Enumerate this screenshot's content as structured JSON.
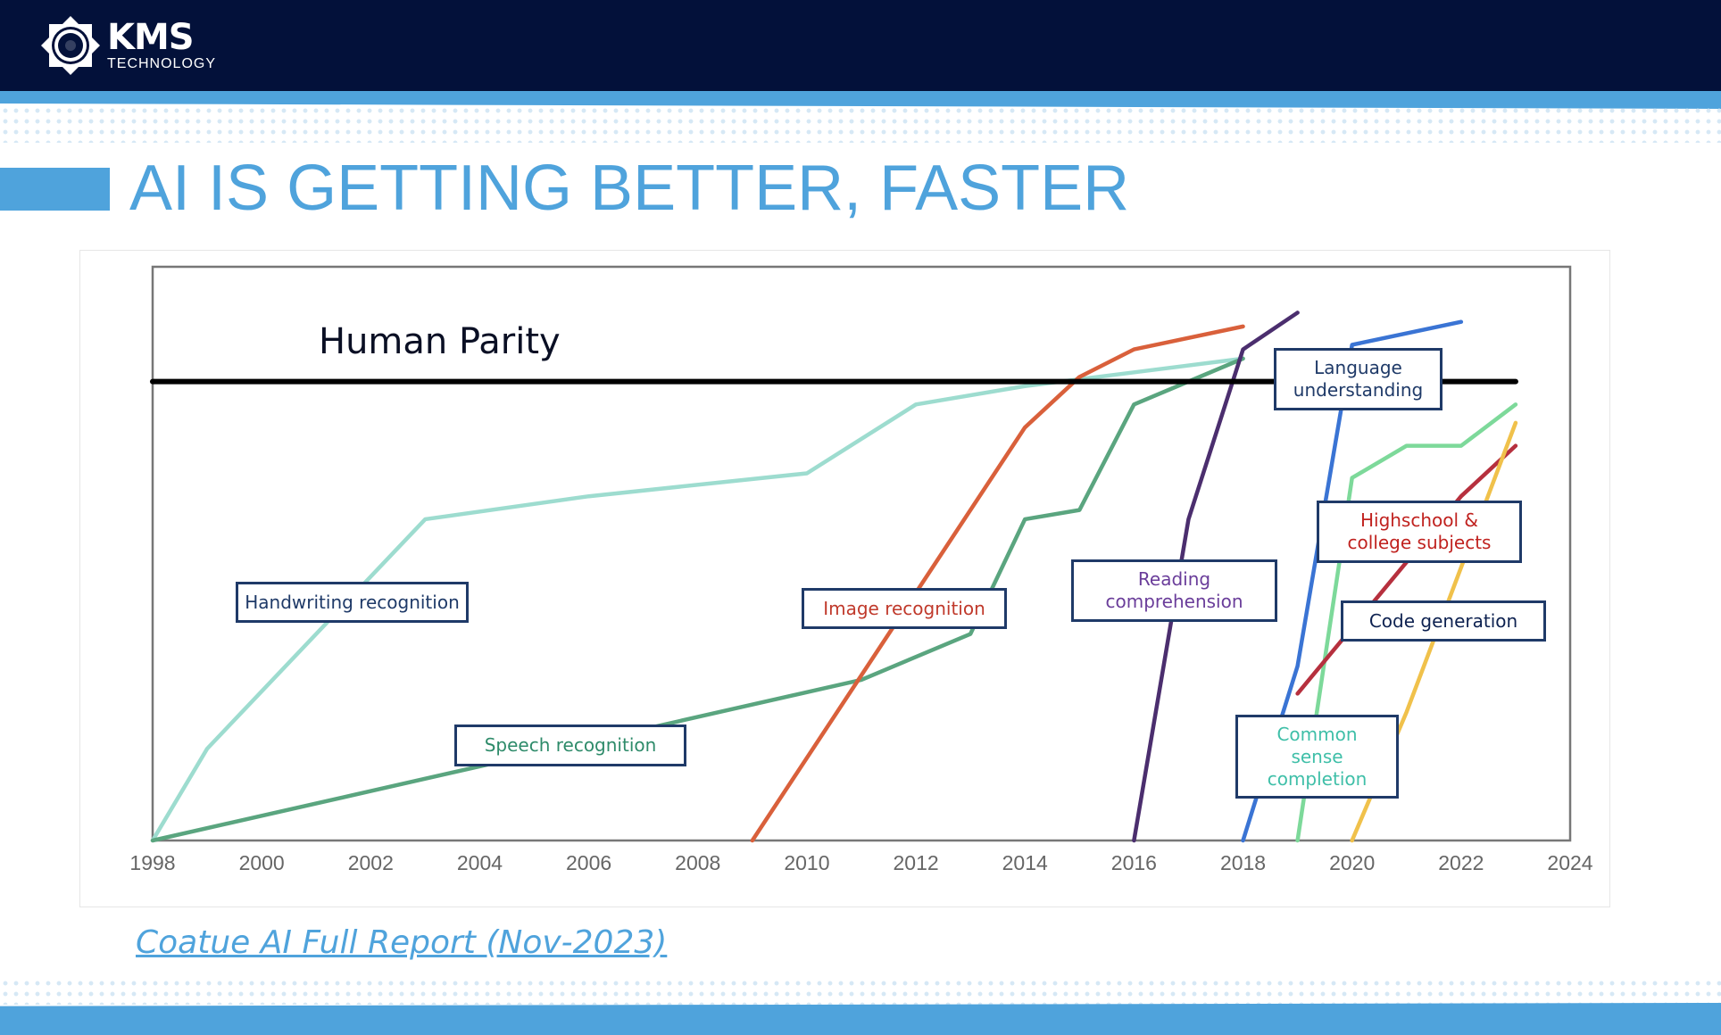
{
  "header": {
    "logo_main": "KMS",
    "logo_sub": "TECHNOLOGY"
  },
  "slide": {
    "title": "AI IS GETTING BETTER, FASTER",
    "source_link": "Coatue AI Full Report (Nov-2023)"
  },
  "colors": {
    "header_bg": "#03113a",
    "accent": "#4fa3dc",
    "label_border": "#1f3a68"
  },
  "chart_data": {
    "type": "line",
    "title": "",
    "xlabel": "",
    "ylabel": "",
    "xlim": [
      1998,
      2024
    ],
    "ylim": [
      -100,
      25
    ],
    "x_ticks": [
      "1998",
      "2000",
      "2002",
      "2004",
      "2006",
      "2008",
      "2010",
      "2012",
      "2014",
      "2016",
      "2018",
      "2020",
      "2022",
      "2024"
    ],
    "grid": false,
    "reference_line": {
      "label": "Human Parity",
      "y": 0,
      "x_range": [
        1998,
        2023
      ]
    },
    "series": [
      {
        "name": "Handwriting recognition",
        "color": "#9ddccf",
        "label_color": "#1f3a68",
        "points": [
          [
            1998,
            -100
          ],
          [
            1999,
            -80
          ],
          [
            2003,
            -30
          ],
          [
            2006,
            -25
          ],
          [
            2010,
            -20
          ],
          [
            2012,
            -5
          ],
          [
            2014,
            -1
          ],
          [
            2016,
            2
          ],
          [
            2018,
            5
          ]
        ]
      },
      {
        "name": "Speech recognition",
        "color": "#5aa57f",
        "label_color": "#2e8b6a",
        "points": [
          [
            1998,
            -100
          ],
          [
            2011,
            -65
          ],
          [
            2013,
            -55
          ],
          [
            2014,
            -30
          ],
          [
            2015,
            -28
          ],
          [
            2016,
            -5
          ],
          [
            2018,
            5
          ]
        ]
      },
      {
        "name": "Image recognition",
        "color": "#d9603b",
        "label_color": "#c0392b",
        "points": [
          [
            2009,
            -100
          ],
          [
            2014,
            -10
          ],
          [
            2015,
            1
          ],
          [
            2016,
            7
          ],
          [
            2018,
            12
          ]
        ]
      },
      {
        "name": "Reading comprehension",
        "color": "#4b2e6e",
        "label_color": "#6a3d9a",
        "points": [
          [
            2016,
            -100
          ],
          [
            2017,
            -30
          ],
          [
            2018,
            7
          ],
          [
            2019,
            15
          ]
        ]
      },
      {
        "name": "Language understanding",
        "color": "#3a74d4",
        "label_color": "#1f3a68",
        "points": [
          [
            2018,
            -100
          ],
          [
            2019,
            -62
          ],
          [
            2019.8,
            -6
          ],
          [
            2020,
            8
          ],
          [
            2022,
            13
          ]
        ]
      },
      {
        "name": "Common sense completion",
        "color": "#7dd99a",
        "label_color": "#3fbfa8",
        "points": [
          [
            2019,
            -100
          ],
          [
            2020,
            -21
          ],
          [
            2021,
            -14
          ],
          [
            2022,
            -14
          ],
          [
            2023,
            -5
          ]
        ]
      },
      {
        "name": "Highschool & college subjects",
        "color": "#b6303e",
        "label_color": "#c0221f",
        "points": [
          [
            2019,
            -68
          ],
          [
            2022,
            -25
          ],
          [
            2023,
            -14
          ]
        ]
      },
      {
        "name": "Code generation",
        "color": "#f0c14b",
        "label_color": "#0d2150",
        "points": [
          [
            2020,
            -100
          ],
          [
            2021,
            -72
          ],
          [
            2023,
            -9
          ]
        ]
      }
    ]
  }
}
